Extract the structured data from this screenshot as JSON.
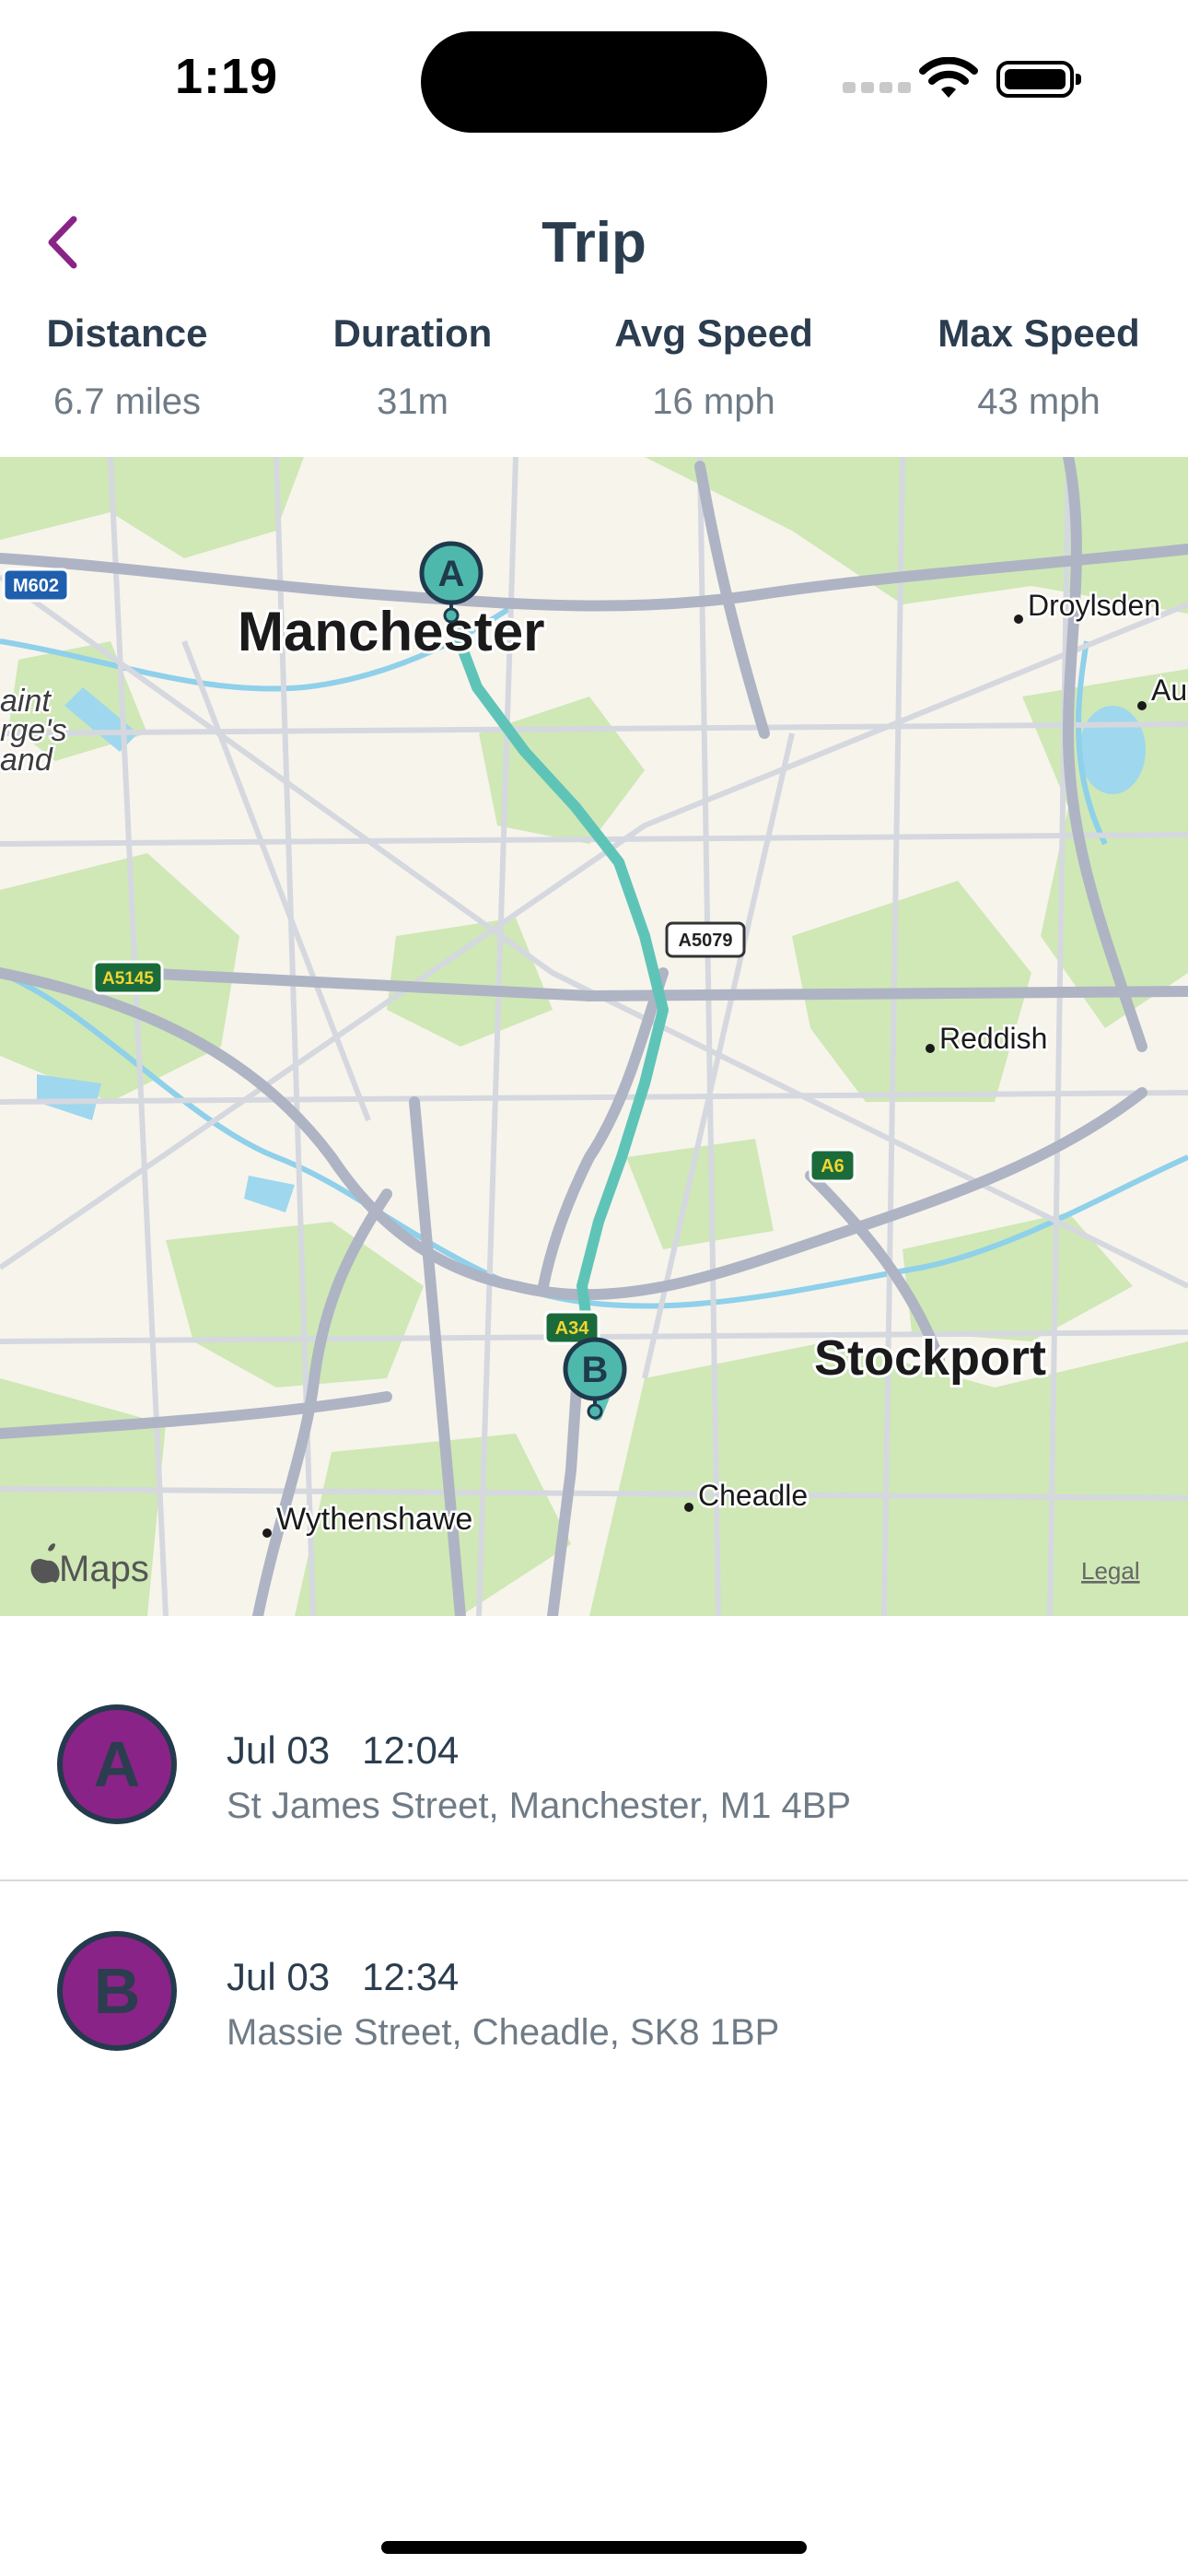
{
  "status": {
    "time": "1:19"
  },
  "nav": {
    "title": "Trip",
    "back_icon": "chevron-left-icon"
  },
  "stats": [
    {
      "label": "Distance",
      "value": "6.7 miles"
    },
    {
      "label": "Duration",
      "value": "31m"
    },
    {
      "label": "Avg Speed",
      "value": "16 mph"
    },
    {
      "label": "Max Speed",
      "value": "43 mph"
    }
  ],
  "map": {
    "places": {
      "manchester": "Manchester",
      "stockport": "Stockport",
      "droylsden": "Droylsden",
      "reddish": "Reddish",
      "wythenshawe": "Wythenshawe",
      "cheadle": "Cheadle",
      "trafford_1": "aint",
      "trafford_2": "rge's",
      "trafford_3": "and",
      "ash": "Au"
    },
    "roads": {
      "m602": "M602",
      "a5145": "A5145",
      "a5079": "A5079",
      "a6": "A6",
      "a34": "A34"
    },
    "markers": {
      "start": "A",
      "end": "B"
    },
    "attribution": "Maps",
    "legal": "Legal",
    "colors": {
      "route": "#5fc4b8",
      "marker": "#4fb8ad",
      "park": "#cfe8b6",
      "road": "#aeb4c4",
      "water": "#9fd7ee"
    }
  },
  "stops": [
    {
      "badge": "A",
      "when": "Jul 03   12:04",
      "address": "St James Street, Manchester, M1  4BP"
    },
    {
      "badge": "B",
      "when": "Jul 03   12:34",
      "address": "Massie Street, Cheadle, SK8 1BP"
    }
  ],
  "colors": {
    "accent": "#8a2387",
    "text": "#2b3d4f",
    "muted": "#6f7b86"
  }
}
